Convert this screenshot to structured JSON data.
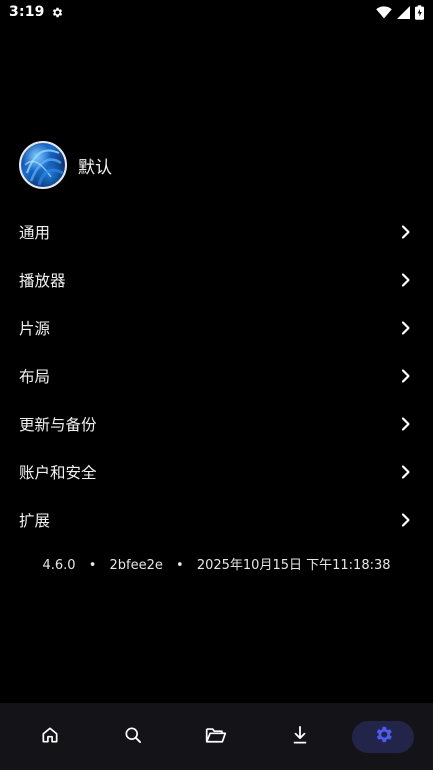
{
  "status_bar": {
    "time": "3:19",
    "icons": [
      "settings-icon",
      "wifi-icon",
      "signal-icon",
      "battery-icon"
    ]
  },
  "profile": {
    "name": "默认"
  },
  "menu": {
    "items": [
      {
        "label": "通用"
      },
      {
        "label": "播放器"
      },
      {
        "label": "片源"
      },
      {
        "label": "布局"
      },
      {
        "label": "更新与备份"
      },
      {
        "label": "账户和安全"
      },
      {
        "label": "扩展"
      }
    ]
  },
  "version": {
    "number": "4.6.0",
    "commit": "2bfee2e",
    "build_date": "2025年10月15日  下午11:18:38"
  },
  "bottom_nav": {
    "items": [
      {
        "icon": "home-icon",
        "active": false
      },
      {
        "icon": "search-icon",
        "active": false
      },
      {
        "icon": "folder-icon",
        "active": false
      },
      {
        "icon": "download-icon",
        "active": false
      },
      {
        "icon": "settings-icon",
        "active": true
      }
    ],
    "accent_color": "#4c5cf0"
  },
  "colors": {
    "background": "#000000",
    "nav_background": "#141318",
    "active_pill": "#23244a"
  }
}
